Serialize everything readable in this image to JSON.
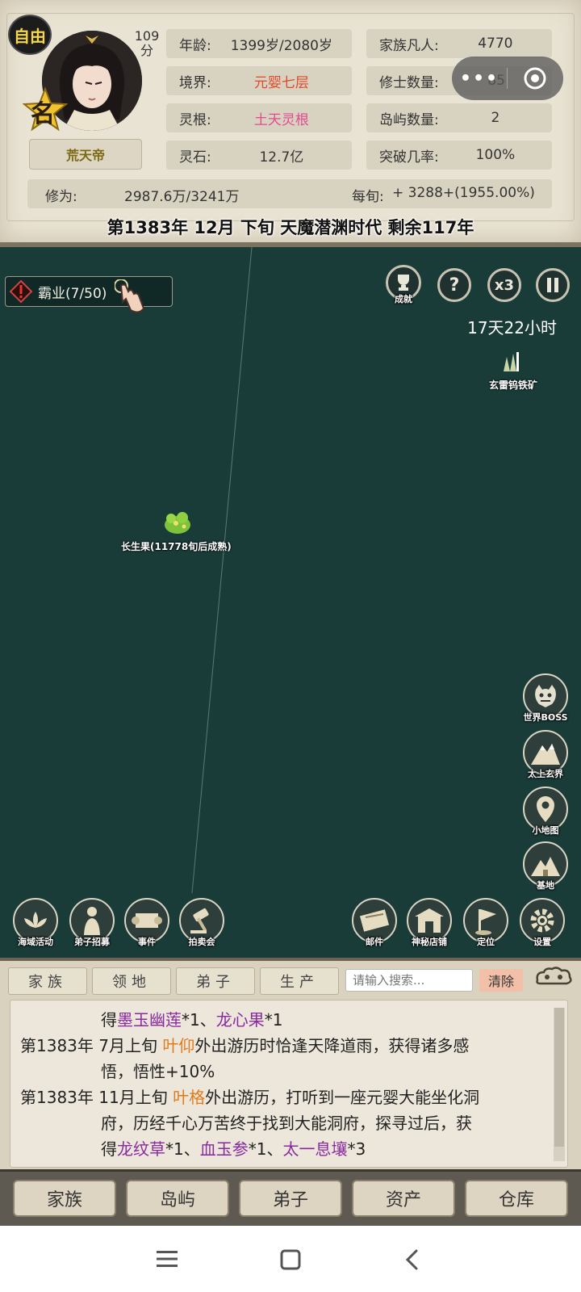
{
  "profile": {
    "mode_badge": "自由",
    "score_value": "109",
    "score_unit": "分",
    "rank_badge": "名",
    "name": "荒天帝"
  },
  "stats": {
    "age_label": "年龄:",
    "age_value": "1399岁/2080岁",
    "realm_label": "境界:",
    "realm_value": "元婴七层",
    "root_label": "灵根:",
    "root_value": "土天灵根",
    "stone_label": "灵石:",
    "stone_value": "12.7亿",
    "mortals_label": "家族凡人:",
    "mortals_value": "4770",
    "cultivators_label": "修士数量:",
    "cultivators_value": "85",
    "islands_label": "岛屿数量:",
    "islands_value": "2",
    "breakthrough_label": "突破几率:",
    "breakthrough_value": "100%",
    "cultivation_label": "修为:",
    "cultivation_value": "2987.6万/3241万",
    "per_xun_label": "每旬:",
    "per_xun_value": "+ 3288+(1955.00%)"
  },
  "date_line": "第1383年 12月 下旬  天魔潜渊时代 剩余117年",
  "map": {
    "quest_label": "霸业(7/50)",
    "timer": "17天22小时",
    "speed_label": "x3",
    "help_label": "?",
    "achievement_label": "成就",
    "ore_label": "玄雷钨铁矿",
    "fruit_label": "长生果(11778旬后成熟)",
    "side_buttons": [
      "世界BOSS",
      "太上玄界",
      "小地图",
      "基地"
    ],
    "bottom_left_buttons": [
      "海域活动",
      "弟子招募",
      "事件",
      "拍卖会"
    ],
    "bottom_right_buttons": [
      "邮件",
      "神秘店铺",
      "定位",
      "设置"
    ]
  },
  "log": {
    "tabs": [
      "家族",
      "领地",
      "弟子",
      "生产"
    ],
    "search_placeholder": "请输入搜索...",
    "clear_label": "清除",
    "l1_a": "得",
    "l1_b": "墨玉幽莲",
    "l1_c": "*1、",
    "l1_d": "龙心果",
    "l1_e": "*1",
    "l2_year": "第1383年",
    "l2_a": "7月上旬 ",
    "l2_name": "叶仰",
    "l2_b": "外出游历时恰逢天降道雨，获得诸多感",
    "l3": "悟，悟性+10%",
    "l4_year": "第1383年",
    "l4_a": "11月上旬 ",
    "l4_name": "叶格",
    "l4_b": "外出游历，打听到一座元婴大能坐化洞",
    "l5": "府，历经千心万苦终于找到大能洞府，探寻过后，获",
    "l6_a": "得",
    "l6_b": "龙纹草",
    "l6_c": "*1、",
    "l6_d": "血玉参",
    "l6_e": "*1、",
    "l6_f": "太一息壤",
    "l6_g": "*3"
  },
  "nav": [
    "家族",
    "岛屿",
    "弟子",
    "资产",
    "仓库"
  ]
}
